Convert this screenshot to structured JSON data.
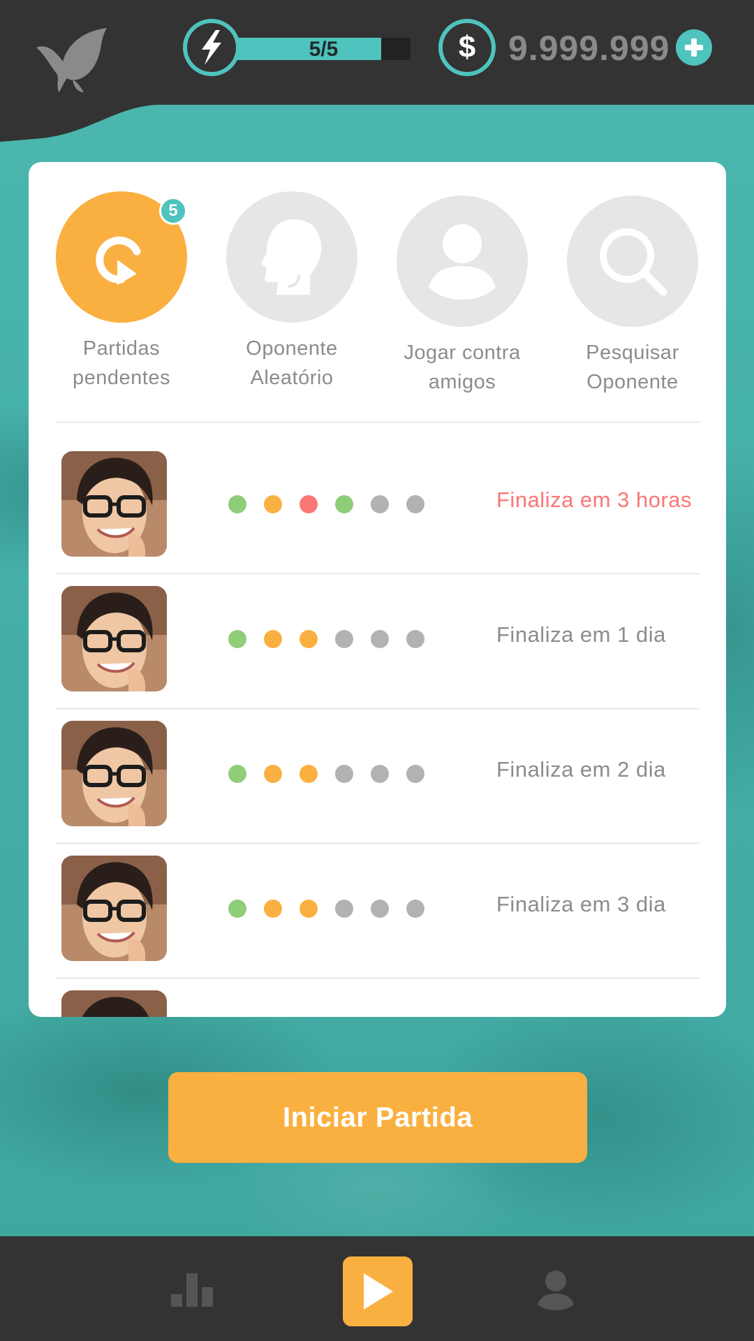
{
  "header": {
    "energy": {
      "text": "5/5",
      "level": 1.0
    },
    "coins": "9.999.999"
  },
  "modes": [
    {
      "label": "Partidas\npendentes",
      "badge": "5",
      "active": true
    },
    {
      "label": "Oponente\nAleatório",
      "active": false
    },
    {
      "label": "Jogar contra\namigos",
      "active": false
    },
    {
      "label": "Pesquisar\nOponente",
      "active": false
    }
  ],
  "matches": [
    {
      "rounds": [
        "green",
        "orange",
        "red",
        "green",
        "gray",
        "gray"
      ],
      "status": "Finaliza em 3 horas",
      "urgent": true
    },
    {
      "rounds": [
        "green",
        "orange",
        "orange",
        "gray",
        "gray",
        "gray"
      ],
      "status": "Finaliza em 1 dia",
      "urgent": false
    },
    {
      "rounds": [
        "green",
        "orange",
        "orange",
        "gray",
        "gray",
        "gray"
      ],
      "status": "Finaliza em 2 dia",
      "urgent": false
    },
    {
      "rounds": [
        "green",
        "orange",
        "orange",
        "gray",
        "gray",
        "gray"
      ],
      "status": "Finaliza em 3 dia",
      "urgent": false
    },
    {
      "rounds": [],
      "status": "",
      "urgent": false
    }
  ],
  "start_button": "Iniciar Partida",
  "bottom_nav": {
    "items": [
      {
        "icon": "bar-chart-icon"
      },
      {
        "icon": "play-icon",
        "active": true
      },
      {
        "icon": "person-icon"
      }
    ]
  },
  "colors": {
    "teal": "#4fc3bd",
    "orange": "#fab040",
    "red": "#f97775",
    "green": "#8fcd78",
    "gray": "#b2b2b2",
    "dark": "#333333"
  }
}
